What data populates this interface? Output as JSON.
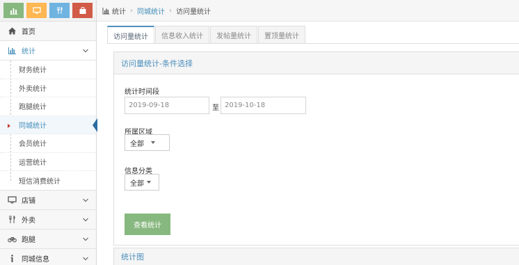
{
  "colors": {
    "shortcut_1": "#87b87f",
    "shortcut_2": "#ffb752",
    "shortcut_3": "#6fb3e0",
    "shortcut_4": "#d15b47",
    "accent": "#438eb9",
    "submit": "#87b87f"
  },
  "shortcuts": [
    {
      "icon": "bar-chart-icon"
    },
    {
      "icon": "monitor-icon"
    },
    {
      "icon": "restaurant-icon"
    },
    {
      "icon": "shopping-bag-icon"
    }
  ],
  "sidebar": {
    "home": {
      "label": "首页",
      "icon": "home-icon"
    },
    "stats": {
      "label": "统计",
      "icon": "bar-chart-icon"
    },
    "stats_sub": [
      "财务统计",
      "外卖统计",
      "跑腿统计",
      "同城统计",
      "会员统计",
      "运营统计",
      "短信消费统计"
    ],
    "stats_sub_active_index": 3,
    "shop": {
      "label": "店铺",
      "icon": "monitor-icon"
    },
    "takeout": {
      "label": "外卖",
      "icon": "restaurant-icon"
    },
    "errand": {
      "label": "跑腿",
      "icon": "bicycle-icon"
    },
    "city_info": {
      "label": "同城信息",
      "icon": "info-icon"
    }
  },
  "breadcrumb": {
    "root": "统计",
    "parent": "同城统计",
    "current": "访问量统计"
  },
  "tabs": [
    "访问量统计",
    "信息收入统计",
    "发帖量统计",
    "置顶量统计"
  ],
  "tabs_active_index": 0,
  "panel": {
    "title": "访问量统计-条件选择",
    "period_label": "统计时间段",
    "date_from": "2019-09-18",
    "to_label": "至",
    "date_to": "2019-10-18",
    "region_label": "所属区域",
    "region_value": "全部",
    "category_label": "信息分类",
    "category_value": "全部",
    "submit_label": "查看统计"
  },
  "chart_panel": {
    "title": "统计图"
  }
}
